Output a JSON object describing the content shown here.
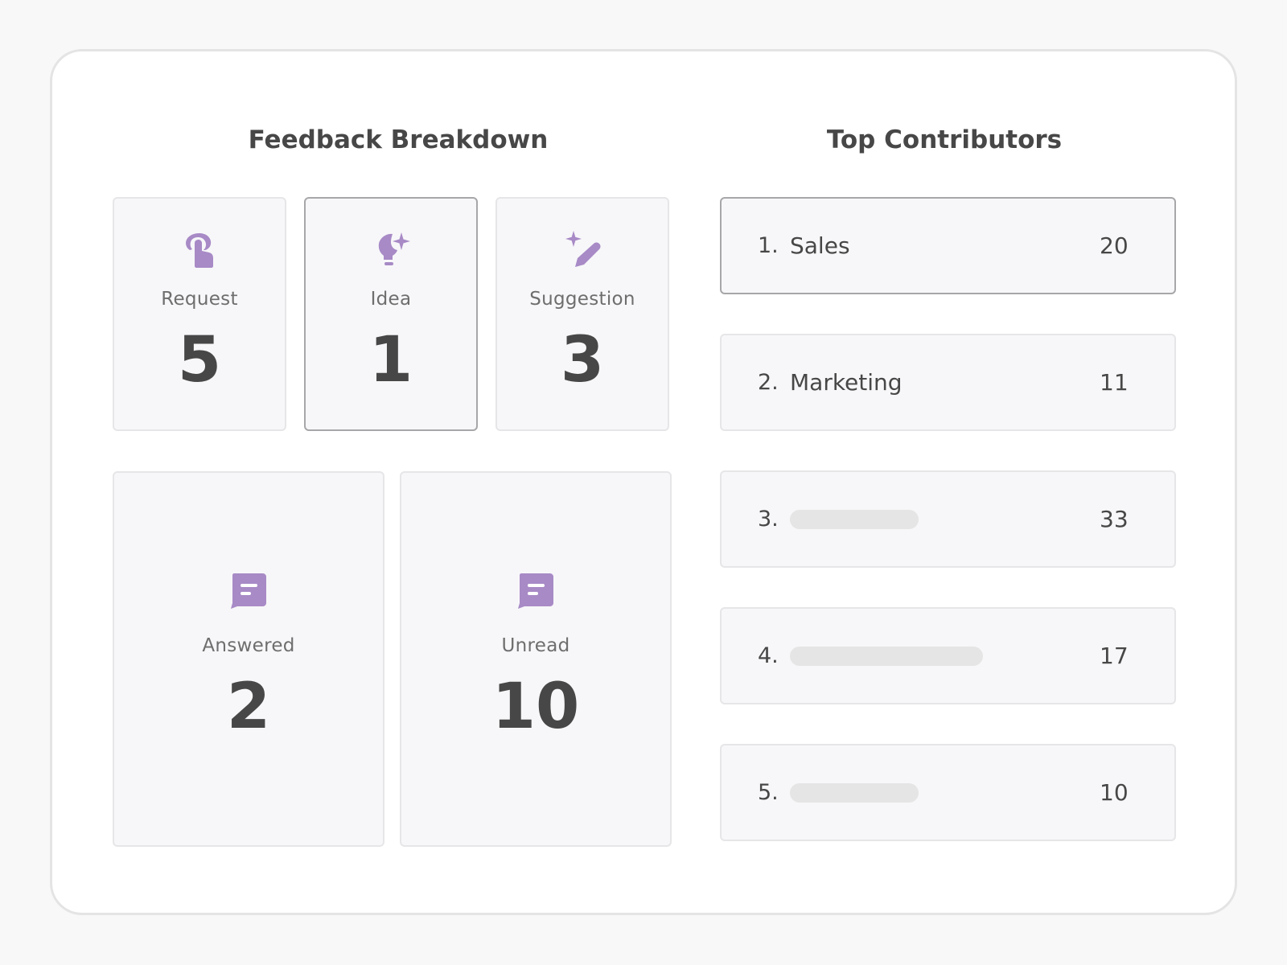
{
  "feedback": {
    "title": "Feedback Breakdown",
    "cards": [
      {
        "label": "Request",
        "value": "5",
        "icon": "tap-hand-icon"
      },
      {
        "label": "Idea",
        "value": "1",
        "icon": "lightbulb-sparkle-icon"
      },
      {
        "label": "Suggestion",
        "value": "3",
        "icon": "magic-pen-icon"
      },
      {
        "label": "Answered",
        "value": "2",
        "icon": "chat-bubble-icon"
      },
      {
        "label": "Unread",
        "value": "10",
        "icon": "chat-bubble-icon"
      }
    ]
  },
  "contributors": {
    "title": "Top Contributors",
    "items": [
      {
        "rank": "1.",
        "name": "Sales",
        "count": "20"
      },
      {
        "rank": "2.",
        "name": "Marketing",
        "count": "11"
      },
      {
        "rank": "3.",
        "name": "",
        "count": "33"
      },
      {
        "rank": "4.",
        "name": "",
        "count": "17"
      },
      {
        "rank": "5.",
        "name": "",
        "count": "10"
      }
    ]
  },
  "colors": {
    "accent": "#a88ac6",
    "text": "#474747",
    "card_bg": "#f7f7f9",
    "placeholder": "#e5e5e5"
  }
}
